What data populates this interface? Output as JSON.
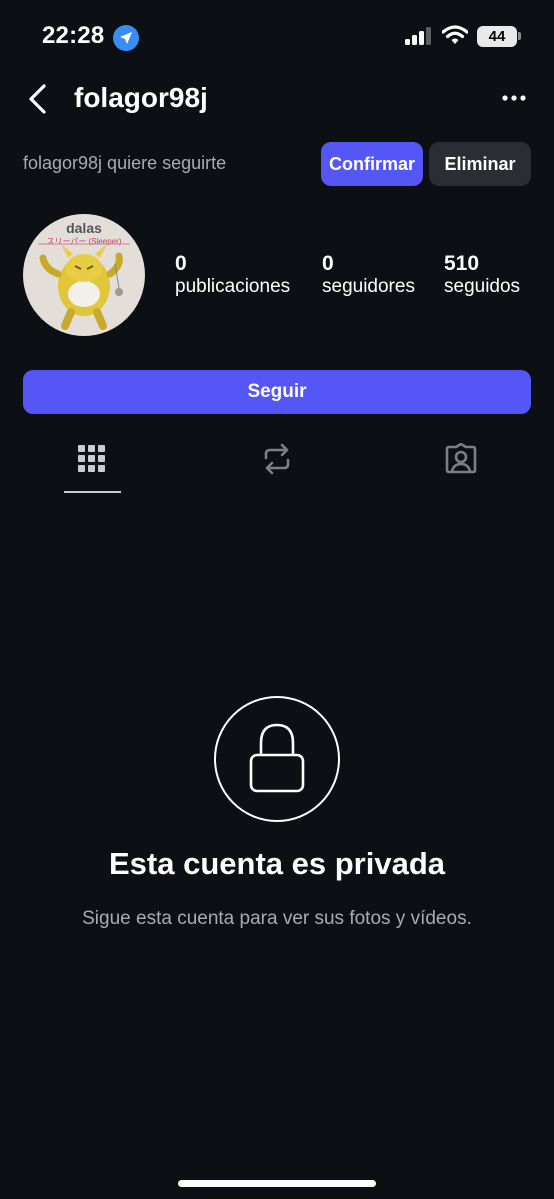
{
  "status_bar": {
    "time": "22:28",
    "battery": "44"
  },
  "header": {
    "username": "folagor98j",
    "back_icon": "chevron-left-icon",
    "more_icon": "more-horizontal-icon"
  },
  "follow_request": {
    "text": "folagor98j quiere seguirte",
    "confirm_label": "Confirmar",
    "delete_label": "Eliminar"
  },
  "profile": {
    "avatar_name": "dalas",
    "avatar_sub": "スリーパー (Sleeper)",
    "stats": [
      {
        "value": "0",
        "label": "publicaciones"
      },
      {
        "value": "0",
        "label": "seguidores"
      },
      {
        "value": "510",
        "label": "seguidos"
      }
    ]
  },
  "follow_button_label": "Seguir",
  "tabs": [
    {
      "icon": "grid-icon",
      "active": true
    },
    {
      "icon": "repost-icon",
      "active": false
    },
    {
      "icon": "tagged-user-icon",
      "active": false
    }
  ],
  "private_notice": {
    "title": "Esta cuenta es privada",
    "subtitle": "Sigue esta cuenta para ver sus fotos y vídeos."
  },
  "colors": {
    "background": "#0c0f14",
    "accent": "#5456f5",
    "secondary_button": "#2a2d33",
    "muted_text": "#a8abb3"
  }
}
